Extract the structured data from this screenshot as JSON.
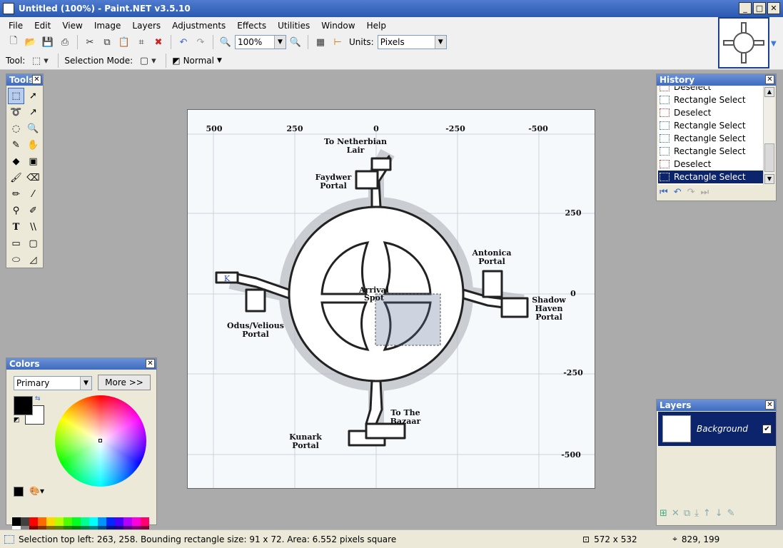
{
  "window": {
    "title": "Untitled (100%) - Paint.NET v3.5.10",
    "minimize": "_",
    "maximize": "□",
    "close": "✕"
  },
  "menu": [
    "File",
    "Edit",
    "View",
    "Image",
    "Layers",
    "Adjustments",
    "Effects",
    "Utilities",
    "Window",
    "Help"
  ],
  "toolbar": {
    "zoom_value": "100%",
    "units_label": "Units:",
    "units_value": "Pixels"
  },
  "toolbar2": {
    "tool_label": "Tool:",
    "selection_mode_label": "Selection Mode:",
    "blend_mode": "Normal"
  },
  "tools_panel": {
    "title": "Tools"
  },
  "history_panel": {
    "title": "History",
    "items": [
      {
        "label": "Deselect",
        "type": "deselect"
      },
      {
        "label": "Rectangle Select",
        "type": "select"
      },
      {
        "label": "Deselect",
        "type": "deselect"
      },
      {
        "label": "Rectangle Select",
        "type": "select"
      },
      {
        "label": "Rectangle Select",
        "type": "select"
      },
      {
        "label": "Rectangle Select",
        "type": "select"
      },
      {
        "label": "Deselect",
        "type": "deselect"
      },
      {
        "label": "Rectangle Select",
        "type": "select",
        "selected": true
      }
    ]
  },
  "colors_panel": {
    "title": "Colors",
    "mode_value": "Primary",
    "more_button": "More >>",
    "primary_color": "#000000",
    "secondary_color": "#ffffff",
    "palette_row1": [
      "#000000",
      "#404040",
      "#ff0000",
      "#ff6a00",
      "#ffd800",
      "#b6ff00",
      "#4cff00",
      "#00ff21",
      "#00ff90",
      "#00ffff",
      "#0094ff",
      "#0026ff",
      "#4800ff",
      "#b200ff",
      "#ff00dc",
      "#ff006e"
    ],
    "palette_row2": [
      "#ffffff",
      "#808080",
      "#7f0000",
      "#7f3300",
      "#7f6a00",
      "#5b7f00",
      "#267f00",
      "#007f0e",
      "#007f46",
      "#007f7f",
      "#004a7f",
      "#00137f",
      "#21007f",
      "#57007f",
      "#7f006e",
      "#7f0037"
    ]
  },
  "layers_panel": {
    "title": "Layers",
    "layers": [
      {
        "name": "Background",
        "visible": "✔"
      }
    ]
  },
  "canvas": {
    "top_labels": [
      "500",
      "250",
      "0",
      "-250",
      "-500"
    ],
    "right_labels": [
      "250",
      "0",
      "-250",
      "-500"
    ],
    "map_labels": {
      "netherbian": [
        "To Netherbian",
        "Lair"
      ],
      "faydwer": [
        "Faydwer",
        "Portal"
      ],
      "antonica": [
        "Antonica",
        "Portal"
      ],
      "shadowhaven": [
        "Shadow",
        "Haven",
        "Portal"
      ],
      "odus": [
        "Odus/Velious",
        "Portal"
      ],
      "arrival": [
        "Arrival",
        "Spot"
      ],
      "kunark": [
        "Kunark",
        "Portal"
      ],
      "bazaar": [
        "To The",
        "Bazaar"
      ],
      "k": "K"
    }
  },
  "status": {
    "selection": "Selection top left: 263, 258. Bounding rectangle size: 91 x 72. Area: 6.552 pixels square",
    "image_size": "572 x 532",
    "cursor": "829, 199"
  }
}
